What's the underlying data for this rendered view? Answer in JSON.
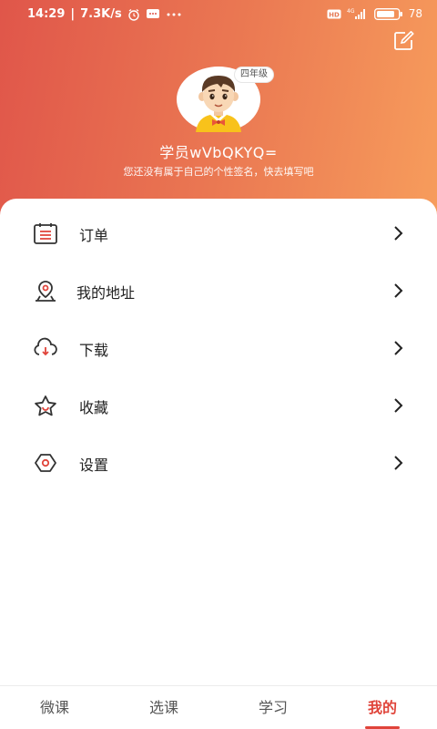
{
  "status_bar": {
    "time": "14:29",
    "speed": "7.3K/s",
    "battery": "78",
    "network": "4G",
    "hd": "HD"
  },
  "profile": {
    "grade": "四年级",
    "username": "学员wVbQKYQ=",
    "signature": "您还没有属于自己的个性签名，快去填写吧"
  },
  "menu": [
    {
      "label": "订单",
      "icon": "order-icon"
    },
    {
      "label": "我的地址",
      "icon": "location-icon"
    },
    {
      "label": "下载",
      "icon": "download-cloud-icon"
    },
    {
      "label": "收藏",
      "icon": "star-icon"
    },
    {
      "label": "设置",
      "icon": "settings-icon"
    }
  ],
  "tabs": [
    {
      "label": "微课"
    },
    {
      "label": "选课"
    },
    {
      "label": "学习"
    },
    {
      "label": "我的"
    }
  ],
  "colors": {
    "accent": "#e0443a",
    "header_start": "#e0564a",
    "header_end": "#f79d5c"
  }
}
